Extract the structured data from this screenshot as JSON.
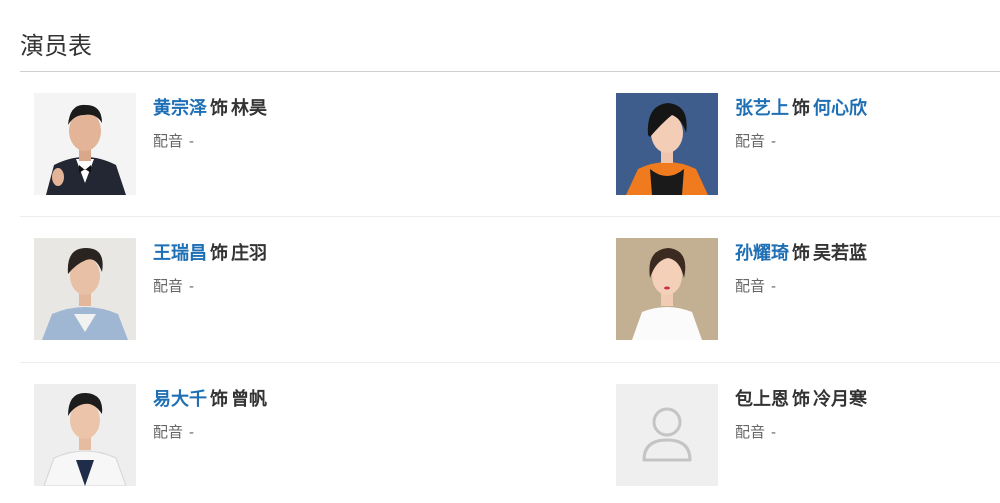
{
  "section": {
    "title": "演员表"
  },
  "role_word": "饰",
  "voice_label": "配音",
  "cast": [
    {
      "actor": "黄宗泽",
      "actor_link": true,
      "character": "林昊",
      "character_link": false,
      "voice": "-",
      "photo": "actor-photo"
    },
    {
      "actor": "张艺上",
      "actor_link": true,
      "character": "何心欣",
      "character_link": true,
      "voice": "-",
      "photo": "actress-photo"
    },
    {
      "actor": "王瑞昌",
      "actor_link": true,
      "character": "庄羽",
      "character_link": false,
      "voice": "-",
      "photo": "actor-photo"
    },
    {
      "actor": "孙耀琦",
      "actor_link": true,
      "character": "吴若蓝",
      "character_link": false,
      "voice": "-",
      "photo": "actress-photo"
    },
    {
      "actor": "易大千",
      "actor_link": true,
      "character": "曾帆",
      "character_link": false,
      "voice": "-",
      "photo": "actor-photo"
    },
    {
      "actor": "包上恩",
      "actor_link": false,
      "character": "冷月寒",
      "character_link": false,
      "voice": "-",
      "photo": "placeholder-person-icon"
    }
  ]
}
